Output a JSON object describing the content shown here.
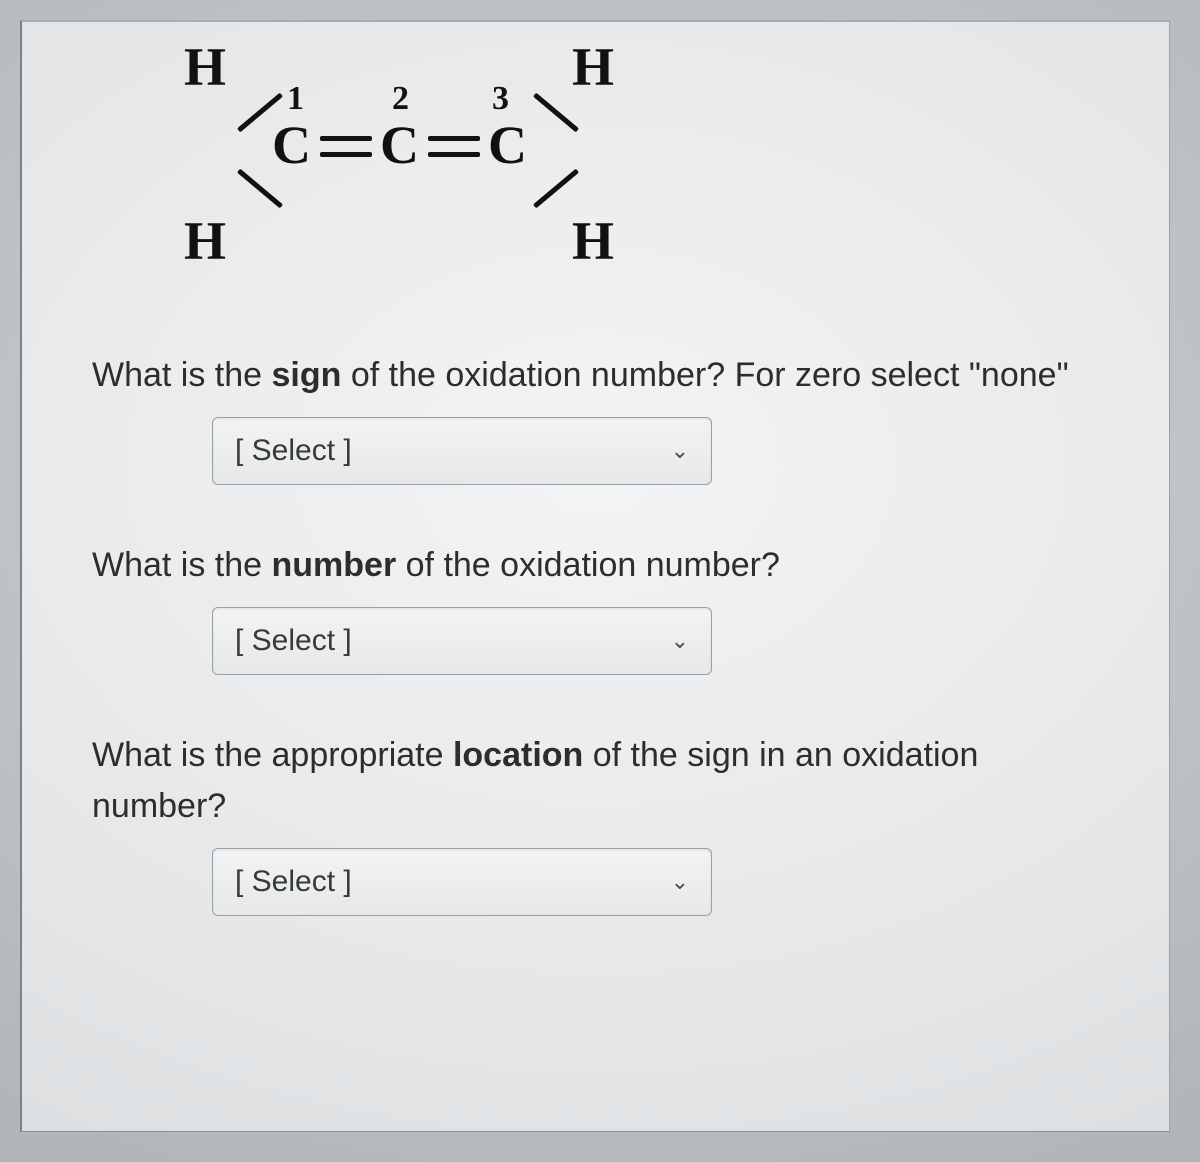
{
  "molecule": {
    "atoms": {
      "c1": "C",
      "c2": "C",
      "c3": "C",
      "hTL": "H",
      "hBL": "H",
      "hTR": "H",
      "hBR": "H"
    },
    "numbers": {
      "n1": "1",
      "n2": "2",
      "n3": "3"
    }
  },
  "questions": [
    {
      "pre": "What is the ",
      "bold": "sign",
      "post": " of the oxidation number?  For zero select \"none\"",
      "select_placeholder": "[ Select ]"
    },
    {
      "pre": "What is the ",
      "bold": "number",
      "post": " of the oxidation number?",
      "select_placeholder": "[ Select ]"
    },
    {
      "pre": "What is the appropriate ",
      "bold": "location",
      "post": " of the sign in an oxidation number?",
      "select_placeholder": "[ Select ]"
    }
  ]
}
